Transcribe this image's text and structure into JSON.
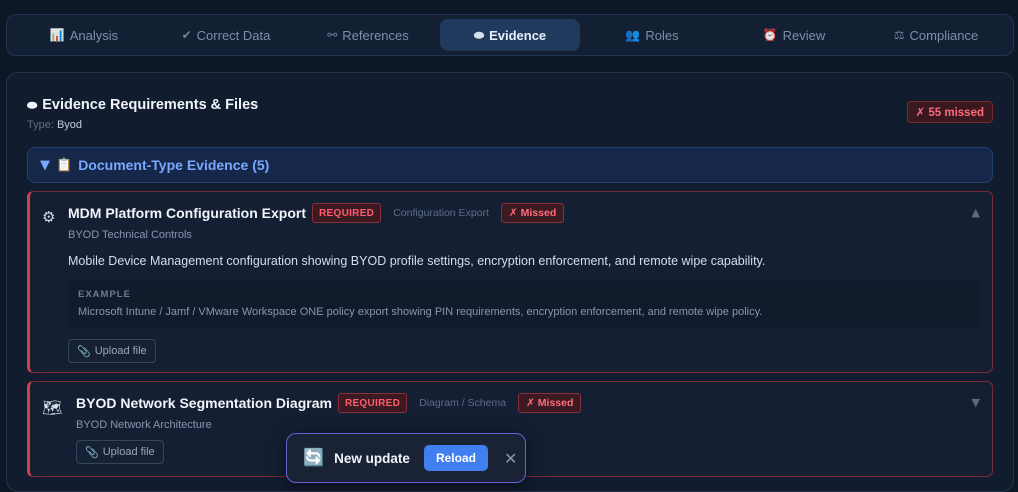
{
  "tabs": [
    {
      "icon": "📊",
      "label": "Analysis",
      "active": false
    },
    {
      "icon": "✔",
      "label": "Correct Data",
      "active": false
    },
    {
      "icon": "⚯",
      "label": "References",
      "active": false
    },
    {
      "icon": "⬬",
      "label": "Evidence",
      "active": true
    },
    {
      "icon": "👥",
      "label": "Roles",
      "active": false
    },
    {
      "icon": "⏰",
      "label": "Review",
      "active": false
    },
    {
      "icon": "⚖",
      "label": "Compliance",
      "active": false
    }
  ],
  "panel": {
    "icon": "⬬",
    "title": "Evidence Requirements & Files",
    "type_label": "Type:",
    "type_value": "Byod",
    "missed_badge": "✗ 55 missed"
  },
  "section": {
    "toggle_icon": "▼",
    "icon": "📋",
    "title": "Document-Type Evidence (5)"
  },
  "cards": [
    {
      "icon": "⚙",
      "title": "MDM Platform Configuration Export",
      "required": "REQUIRED",
      "evidence_type": "Configuration Export",
      "status": "✗ Missed",
      "subtitle": "BYOD Technical Controls",
      "description": "Mobile Device Management configuration showing BYOD profile settings, encryption enforcement, and remote wipe capability.",
      "example_label": "EXAMPLE",
      "example_text": "Microsoft Intune / Jamf / VMware Workspace ONE policy export showing PIN requirements, encryption enforcement, and remote wipe policy.",
      "upload_label": "Upload file",
      "chevron": "▲"
    },
    {
      "icon": "🗺",
      "title": "BYOD Network Segmentation Diagram",
      "required": "REQUIRED",
      "evidence_type": "Diagram / Schema",
      "status": "✗ Missed",
      "subtitle": "BYOD Network Architecture",
      "upload_label": "Upload file",
      "chevron": "▼"
    }
  ],
  "toast": {
    "icon": "🔄",
    "message": "New update",
    "reload_label": "Reload",
    "close_icon": "✕"
  },
  "colors": {
    "background": "#0e1726",
    "accent": "#3f7ff0",
    "danger": "#ff6b7a",
    "section_title": "#7aa8ff"
  }
}
